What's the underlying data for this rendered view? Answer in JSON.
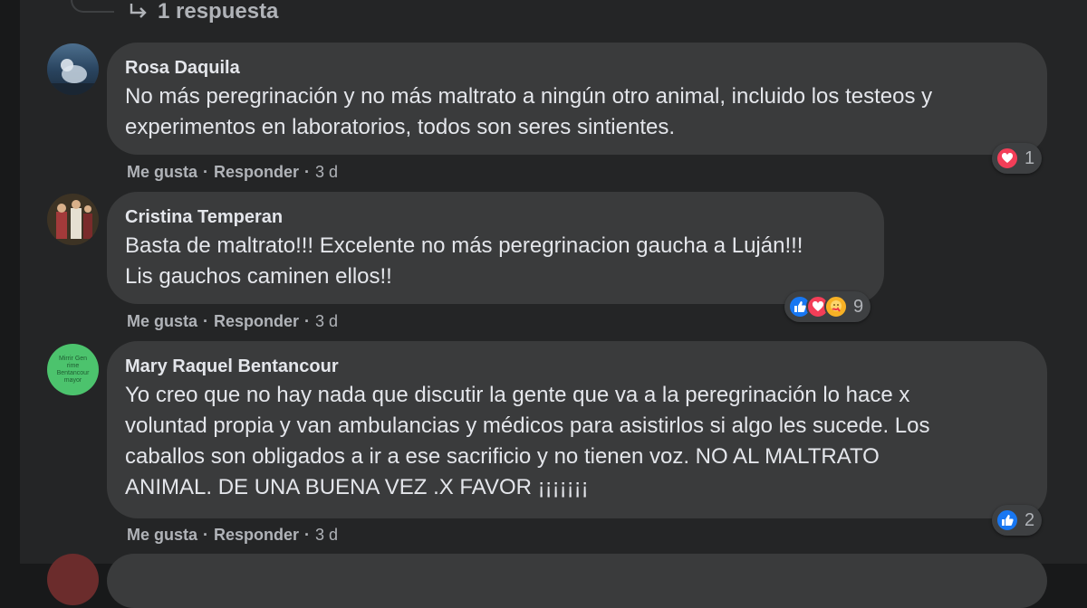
{
  "thread": {
    "reply_link": "1 respuesta"
  },
  "comments": [
    {
      "author": "Rosa Daquila",
      "lines": [
        "No más peregrinación y no más maltrato a ningún otro animal, incluido los testeos y",
        "experimentos en laboratorios, todos son seres sintientes."
      ],
      "like_label": "Me gusta",
      "reply_label": "Responder",
      "time": "3 d",
      "reactions": [
        "love-icon"
      ],
      "reaction_count": "1"
    },
    {
      "author": "Cristina Temperan",
      "lines": [
        "Basta de maltrato!!! Excelente no más peregrinacion gaucha a Luján!!!",
        "Lis gauchos caminen ellos!!"
      ],
      "like_label": "Me gusta",
      "reply_label": "Responder",
      "time": "3 d",
      "reactions": [
        "like-icon",
        "love-icon",
        "care-icon"
      ],
      "reaction_count": "9"
    },
    {
      "author": "Mary Raquel Bentancour",
      "avatar_text": "Mirrir Gen rime Bentancour mayor",
      "lines": [
        "Yo creo que no hay nada que discutir la gente que va a la peregrinación lo hace x",
        "voluntad propia y van ambulancias y médicos para asistirlos si algo les sucede. Los",
        "caballos son obligados a ir a ese sacrificio y no tienen voz. NO AL MALTRATO",
        "ANIMAL. DE UNA BUENA VEZ .X FAVOR ¡¡¡¡¡¡¡"
      ],
      "like_label": "Me gusta",
      "reply_label": "Responder",
      "time": "3 d",
      "reactions": [
        "like-icon"
      ],
      "reaction_count": "2"
    }
  ],
  "colors": {
    "like": "#1877f2",
    "love": "#f33e58",
    "care": "#f7b125",
    "avatar_green": "#4cc36d"
  }
}
